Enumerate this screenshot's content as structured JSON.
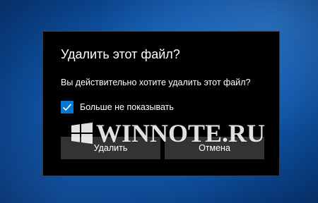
{
  "dialog": {
    "title": "Удалить этот файл?",
    "message": "Вы действительно хотите удалить этот файл?",
    "checkbox": {
      "label": "Больше не показывать",
      "checked": true
    },
    "buttons": {
      "delete_label": "Удалить",
      "cancel_label": "Отмена"
    }
  },
  "watermark": {
    "text": "WINNOTE.RU",
    "logo_icon": "windows-logo-icon"
  },
  "colors": {
    "accent": "#0078d7",
    "dialog_background": "#000000",
    "button_background": "#333333",
    "desktop_background": "#0f56a8"
  }
}
